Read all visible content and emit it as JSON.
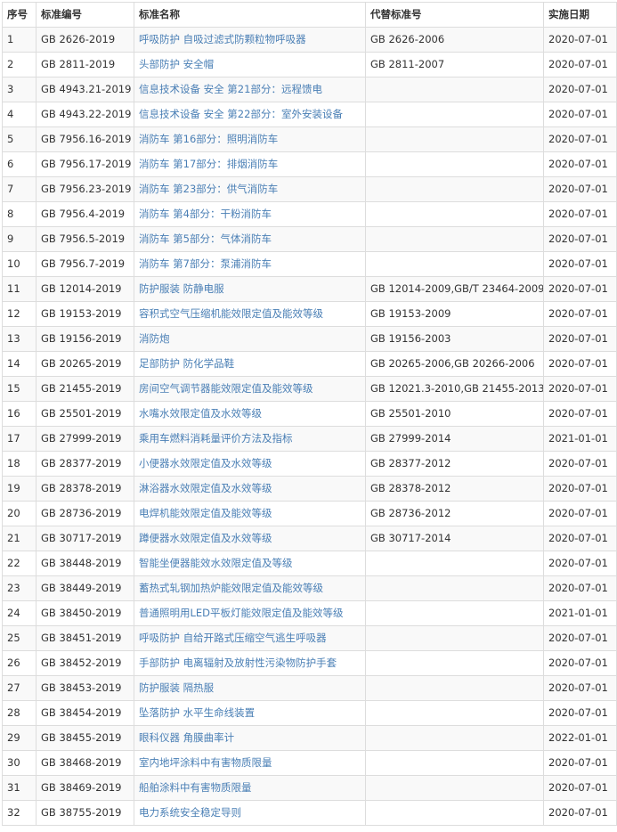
{
  "table": {
    "headers": {
      "seq": "序号",
      "code": "标准编号",
      "name": "标准名称",
      "replaces": "代替标准号",
      "date": "实施日期"
    },
    "rows": [
      {
        "seq": "1",
        "code": "GB 2626-2019",
        "name": "呼吸防护 自吸过滤式防颗粒物呼吸器",
        "replaces": "GB 2626-2006",
        "date": "2020-07-01"
      },
      {
        "seq": "2",
        "code": "GB 2811-2019",
        "name": "头部防护 安全帽",
        "replaces": "GB 2811-2007",
        "date": "2020-07-01"
      },
      {
        "seq": "3",
        "code": "GB 4943.21-2019",
        "name": "信息技术设备 安全 第21部分：远程馈电",
        "replaces": "",
        "date": "2020-07-01"
      },
      {
        "seq": "4",
        "code": "GB 4943.22-2019",
        "name": "信息技术设备 安全 第22部分：室外安装设备",
        "replaces": "",
        "date": "2020-07-01"
      },
      {
        "seq": "5",
        "code": "GB 7956.16-2019",
        "name": "消防车 第16部分：照明消防车",
        "replaces": "",
        "date": "2020-07-01"
      },
      {
        "seq": "6",
        "code": "GB 7956.17-2019",
        "name": "消防车 第17部分：排烟消防车",
        "replaces": "",
        "date": "2020-07-01"
      },
      {
        "seq": "7",
        "code": "GB 7956.23-2019",
        "name": "消防车 第23部分：供气消防车",
        "replaces": "",
        "date": "2020-07-01"
      },
      {
        "seq": "8",
        "code": "GB 7956.4-2019",
        "name": "消防车 第4部分：干粉消防车",
        "replaces": "",
        "date": "2020-07-01"
      },
      {
        "seq": "9",
        "code": "GB 7956.5-2019",
        "name": "消防车 第5部分：气体消防车",
        "replaces": "",
        "date": "2020-07-01"
      },
      {
        "seq": "10",
        "code": "GB 7956.7-2019",
        "name": "消防车 第7部分：泵浦消防车",
        "replaces": "",
        "date": "2020-07-01"
      },
      {
        "seq": "11",
        "code": "GB 12014-2019",
        "name": "防护服装 防静电服",
        "replaces": "GB 12014-2009,GB/T 23464-2009",
        "date": "2020-07-01"
      },
      {
        "seq": "12",
        "code": "GB 19153-2019",
        "name": "容积式空气压缩机能效限定值及能效等级",
        "replaces": "GB 19153-2009",
        "date": "2020-07-01"
      },
      {
        "seq": "13",
        "code": "GB 19156-2019",
        "name": "消防炮",
        "replaces": "GB 19156-2003",
        "date": "2020-07-01"
      },
      {
        "seq": "14",
        "code": "GB 20265-2019",
        "name": "足部防护 防化学品鞋",
        "replaces": "GB 20265-2006,GB 20266-2006",
        "date": "2020-07-01"
      },
      {
        "seq": "15",
        "code": "GB 21455-2019",
        "name": "房间空气调节器能效限定值及能效等级",
        "replaces": "GB 12021.3-2010,GB 21455-2013",
        "date": "2020-07-01"
      },
      {
        "seq": "16",
        "code": "GB 25501-2019",
        "name": "水嘴水效限定值及水效等级",
        "replaces": "GB 25501-2010",
        "date": "2020-07-01"
      },
      {
        "seq": "17",
        "code": "GB 27999-2019",
        "name": "乘用车燃料消耗量评价方法及指标",
        "replaces": "GB 27999-2014",
        "date": "2021-01-01"
      },
      {
        "seq": "18",
        "code": "GB 28377-2019",
        "name": "小便器水效限定值及水效等级",
        "replaces": "GB 28377-2012",
        "date": "2020-07-01"
      },
      {
        "seq": "19",
        "code": "GB 28378-2019",
        "name": "淋浴器水效限定值及水效等级",
        "replaces": "GB 28378-2012",
        "date": "2020-07-01"
      },
      {
        "seq": "20",
        "code": "GB 28736-2019",
        "name": "电焊机能效限定值及能效等级",
        "replaces": "GB 28736-2012",
        "date": "2020-07-01"
      },
      {
        "seq": "21",
        "code": "GB 30717-2019",
        "name": "蹲便器水效限定值及水效等级",
        "replaces": "GB 30717-2014",
        "date": "2020-07-01"
      },
      {
        "seq": "22",
        "code": "GB 38448-2019",
        "name": "智能坐便器能效水效限定值及等级",
        "replaces": "",
        "date": "2020-07-01"
      },
      {
        "seq": "23",
        "code": "GB 38449-2019",
        "name": "蓄热式轧钢加热炉能效限定值及能效等级",
        "replaces": "",
        "date": "2020-07-01"
      },
      {
        "seq": "24",
        "code": "GB 38450-2019",
        "name": "普通照明用LED平板灯能效限定值及能效等级",
        "replaces": "",
        "date": "2021-01-01"
      },
      {
        "seq": "25",
        "code": "GB 38451-2019",
        "name": "呼吸防护 自给开路式压缩空气逃生呼吸器",
        "replaces": "",
        "date": "2020-07-01"
      },
      {
        "seq": "26",
        "code": "GB 38452-2019",
        "name": "手部防护 电离辐射及放射性污染物防护手套",
        "replaces": "",
        "date": "2020-07-01"
      },
      {
        "seq": "27",
        "code": "GB 38453-2019",
        "name": "防护服装 隔热服",
        "replaces": "",
        "date": "2020-07-01"
      },
      {
        "seq": "28",
        "code": "GB 38454-2019",
        "name": "坠落防护 水平生命线装置",
        "replaces": "",
        "date": "2020-07-01"
      },
      {
        "seq": "29",
        "code": "GB 38455-2019",
        "name": "眼科仪器 角膜曲率计",
        "replaces": "",
        "date": "2022-01-01"
      },
      {
        "seq": "30",
        "code": "GB 38468-2019",
        "name": "室内地坪涂料中有害物质限量",
        "replaces": "",
        "date": "2020-07-01"
      },
      {
        "seq": "31",
        "code": "GB 38469-2019",
        "name": "船舶涂料中有害物质限量",
        "replaces": "",
        "date": "2020-07-01"
      },
      {
        "seq": "32",
        "code": "GB 38755-2019",
        "name": "电力系统安全稳定导则",
        "replaces": "",
        "date": "2020-07-01"
      }
    ]
  },
  "colors": {
    "link": "#4a7fb5",
    "border": "#dddddd",
    "stripe": "#f9f9f9",
    "text": "#333333"
  }
}
